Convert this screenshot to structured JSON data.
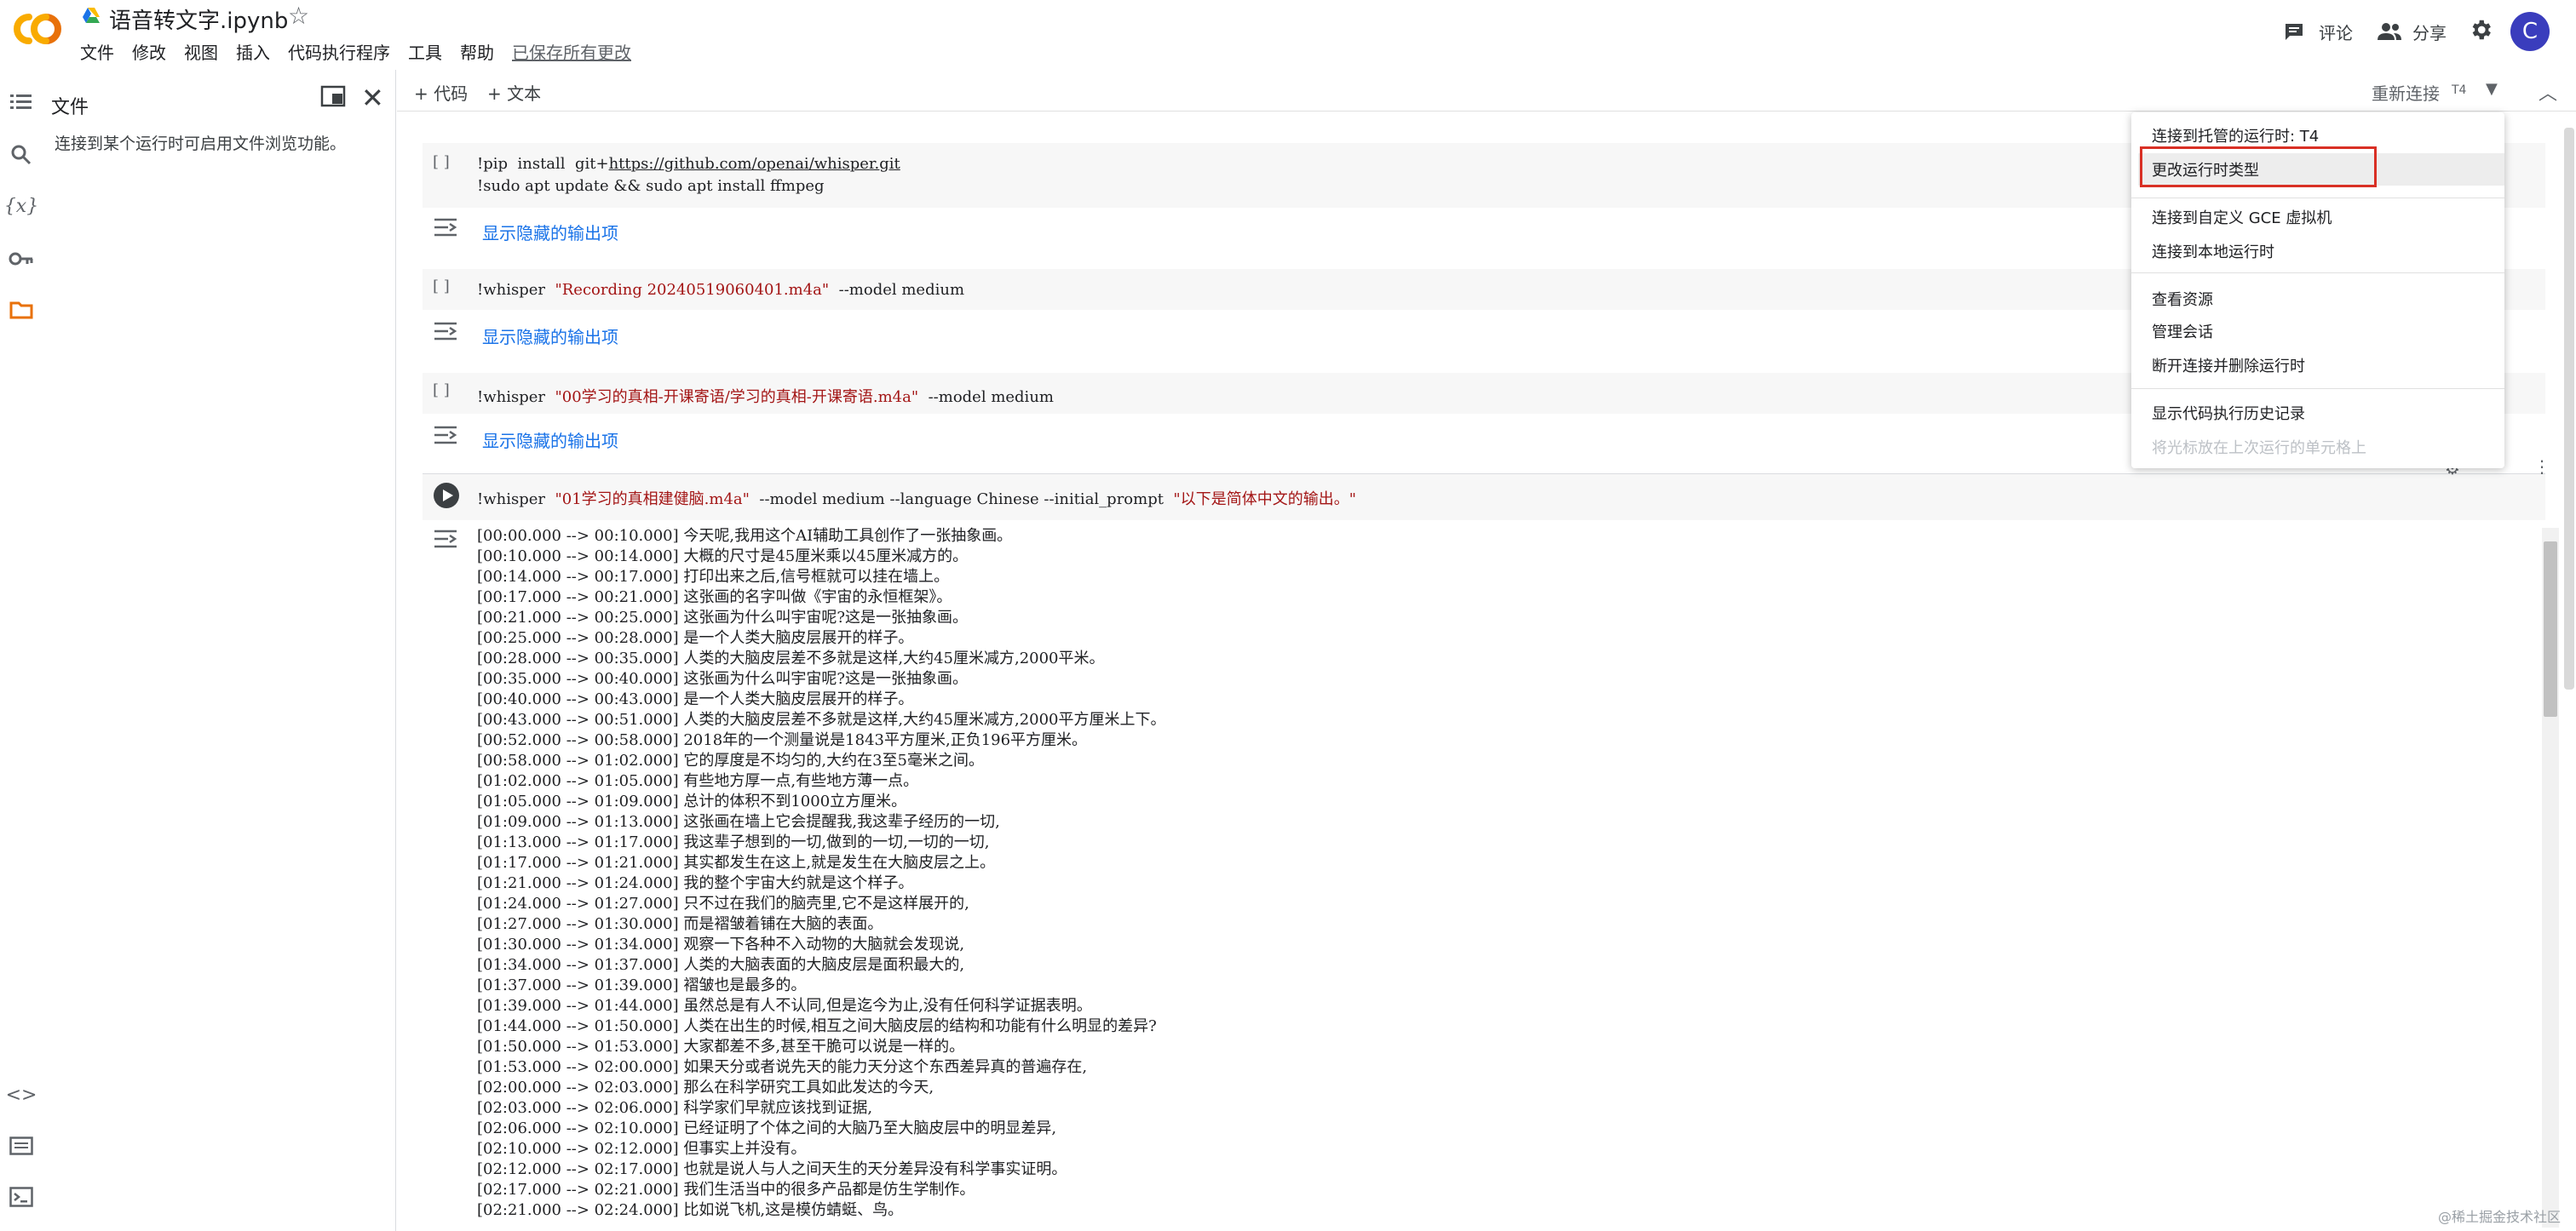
{
  "header": {
    "title": "语音转文字.ipynb",
    "menu": [
      "文件",
      "修改",
      "视图",
      "插入",
      "代码执行程序",
      "工具",
      "帮助"
    ],
    "saved_status": "已保存所有更改",
    "comment_label": "评论",
    "share_label": "分享",
    "avatar_initial": "C"
  },
  "file_panel": {
    "title": "文件",
    "message": "连接到某个运行时可启用文件浏览功能。"
  },
  "toolbar": {
    "add_code": "+ 代码",
    "add_text": "+ 文本",
    "reconnect": "重新连接",
    "gpu": "T4"
  },
  "cells": [
    {
      "bracket": "[ ]",
      "lines": [
        "!pip  install  git+https://github.com/openai/whisper.git",
        "!sudo  apt  update  &&  sudo  apt  install  ffmpeg"
      ],
      "output_toggle": "显示隐藏的输出项"
    },
    {
      "bracket": "[ ]",
      "cmd": "!whisper",
      "arg": "\"Recording  20240519060401.m4a\"",
      "rest": "--model  medium",
      "output_toggle": "显示隐藏的输出项"
    },
    {
      "bracket": "[ ]",
      "cmd": "!whisper",
      "arg": "\"00学习的真相-开课寄语/学习的真相-开课寄语.m4a\"",
      "rest": "--model  medium",
      "output_toggle": "显示隐藏的输出项"
    },
    {
      "cmd": "!whisper",
      "arg": "\"01学习的真相建健脑.m4a\"",
      "rest": "--model  medium  --language  Chinese  --initial_prompt",
      "arg2": "\"以下是简体中文的输出。\""
    }
  ],
  "output_lines": [
    "[00:00.000 --> 00:10.000] 今天呢,我用这个AI辅助工具创作了一张抽象画。",
    "[00:10.000 --> 00:14.000] 大概的尺寸是45厘米乘以45厘米减方的。",
    "[00:14.000 --> 00:17.000] 打印出来之后,信号框就可以挂在墙上。",
    "[00:17.000 --> 00:21.000] 这张画的名字叫做《宇宙的永恒框架》。",
    "[00:21.000 --> 00:25.000] 这张画为什么叫宇宙呢?这是一张抽象画。",
    "[00:25.000 --> 00:28.000] 是一个人类大脑皮层展开的样子。",
    "[00:28.000 --> 00:35.000] 人类的大脑皮层差不多就是这样,大约45厘米减方,2000平米。",
    "[00:35.000 --> 00:40.000] 这张画为什么叫宇宙呢?这是一张抽象画。",
    "[00:40.000 --> 00:43.000] 是一个人类大脑皮层展开的样子。",
    "[00:43.000 --> 00:51.000] 人类的大脑皮层差不多就是这样,大约45厘米减方,2000平方厘米上下。",
    "[00:52.000 --> 00:58.000] 2018年的一个测量说是1843平方厘米,正负196平方厘米。",
    "[00:58.000 --> 01:02.000] 它的厚度是不均匀的,大约在3至5毫米之间。",
    "[01:02.000 --> 01:05.000] 有些地方厚一点,有些地方薄一点。",
    "[01:05.000 --> 01:09.000] 总计的体积不到1000立方厘米。",
    "[01:09.000 --> 01:13.000] 这张画在墙上它会提醒我,我这辈子经历的一切,",
    "[01:13.000 --> 01:17.000] 我这辈子想到的一切,做到的一切,一切的一切,",
    "[01:17.000 --> 01:21.000] 其实都发生在这上,就是发生在大脑皮层之上。",
    "[01:21.000 --> 01:24.000] 我的整个宇宙大约就是这个样子。",
    "[01:24.000 --> 01:27.000] 只不过在我们的脑壳里,它不是这样展开的,",
    "[01:27.000 --> 01:30.000] 而是褶皱着铺在大脑的表面。",
    "[01:30.000 --> 01:34.000] 观察一下各种不入动物的大脑就会发现说,",
    "[01:34.000 --> 01:37.000] 人类的大脑表面的大脑皮层是面积最大的,",
    "[01:37.000 --> 01:39.000] 褶皱也是最多的。",
    "[01:39.000 --> 01:44.000] 虽然总是有人不认同,但是迄今为止,没有任何科学证据表明。",
    "[01:44.000 --> 01:50.000] 人类在出生的时候,相互之间大脑皮层的结构和功能有什么明显的差异?",
    "[01:50.000 --> 01:53.000] 大家都差不多,甚至干脆可以说是一样的。",
    "[01:53.000 --> 02:00.000] 如果天分或者说先天的能力天分这个东西差异真的普遍存在,",
    "[02:00.000 --> 02:03.000] 那么在科学研究工具如此发达的今天,",
    "[02:03.000 --> 02:06.000] 科学家们早就应该找到证据,",
    "[02:06.000 --> 02:10.000] 已经证明了个体之间的大脑乃至大脑皮层中的明显差异,",
    "[02:10.000 --> 02:12.000] 但事实上并没有。",
    "[02:12.000 --> 02:17.000] 也就是说人与人之间天生的天分差异没有科学事实证明。",
    "[02:17.000 --> 02:21.000] 我们生活当中的很多产品都是仿生学制作。",
    "[02:21.000 --> 02:24.000] 比如说飞机,这是模仿蜻蜓、鸟。"
  ],
  "runtime_menu": {
    "items": [
      "连接到托管的运行时: T4",
      "更改运行时类型",
      "连接到自定义 GCE 虚拟机",
      "连接到本地运行时",
      "查看资源",
      "管理会话",
      "断开连接并删除运行时",
      "显示代码执行历史记录",
      "将光标放在上次运行的单元格上"
    ]
  },
  "watermark": "@稀土掘金技术社区",
  "colors": {
    "accent": "#1a73e8",
    "string": "#a31515",
    "highlight_box": "#d93025",
    "colab_orange": "#f9ab00"
  }
}
